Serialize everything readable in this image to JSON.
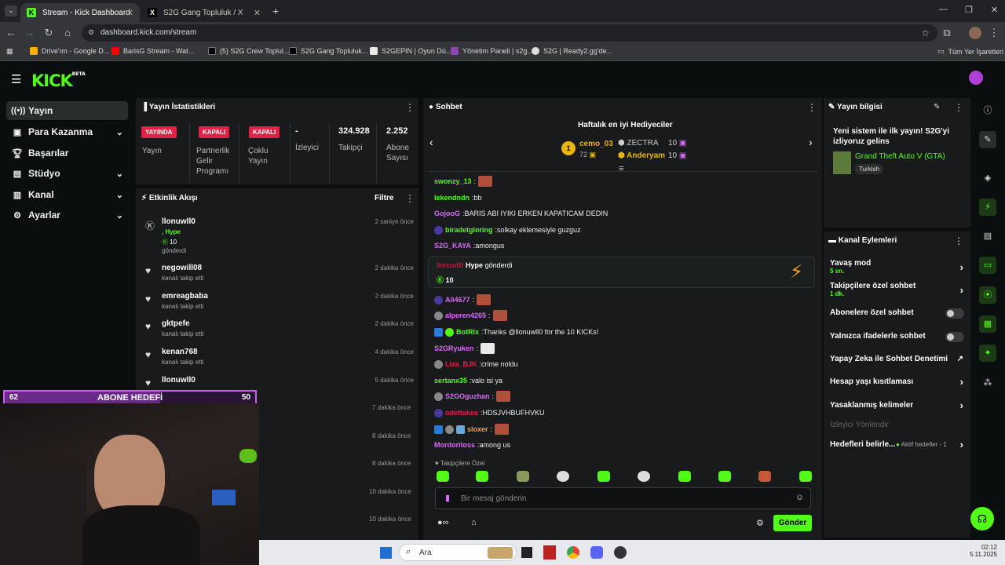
{
  "browser": {
    "tabs": [
      {
        "label": "Stream - Kick Dashboard",
        "active": true
      },
      {
        "label": "S2G Gang Topluluk / X",
        "active": false
      }
    ],
    "url": "dashboard.kick.com/stream",
    "bookmarks": [
      "Drive'ım - Google D...",
      "BarisG Stream - Wat...",
      "(5) S2G Crew Toplul...",
      "S2G Gang Topluluk...",
      "S2GEPIN | Oyun Dü...",
      "Yönetim Paneli | s2g...",
      "S2G | Ready2.gg'de..."
    ],
    "all_bookmarks": "Tüm Yer İşaretleri"
  },
  "header": {
    "logo": "KICK",
    "beta": "BETA"
  },
  "sidebar": {
    "items": [
      {
        "label": "Yayın",
        "active": true
      },
      {
        "label": "Para Kazanma",
        "chevron": true
      },
      {
        "label": "Başarılar"
      },
      {
        "label": "Stüdyo",
        "chevron": true
      },
      {
        "label": "Kanal",
        "chevron": true
      },
      {
        "label": "Ayarlar",
        "chevron": true
      }
    ]
  },
  "stats": {
    "title": "Yayın İstatistikleri",
    "cols": [
      {
        "badge": "YAYINDA",
        "label": "Yayın"
      },
      {
        "badge": "KAPALI",
        "label": "Partnerlik Gelir Programı"
      },
      {
        "badge": "KAPALI",
        "label": "Çoklu Yayın"
      },
      {
        "value": "-",
        "label": "İzleyici"
      },
      {
        "value": "324.928",
        "label": "Takipçi"
      },
      {
        "value": "2.252",
        "label": "Abone Sayısı"
      }
    ]
  },
  "activity": {
    "title": "Etkinlik Akışı",
    "filter": "Filtre",
    "events": [
      {
        "name": "llonuwll0",
        "extra": ", Hype",
        "amount": "10",
        "sub": "gönderdi",
        "time": "2 saniye önce"
      },
      {
        "name": "negowill08",
        "sub": "kanalı takip etti",
        "time": "2 dakika önce"
      },
      {
        "name": "emreagbaba",
        "sub": "kanalı takip etti",
        "time": "2 dakika önce"
      },
      {
        "name": "gktpefe",
        "sub": "kanalı takip etti",
        "time": "2 dakika önce"
      },
      {
        "name": "kenan768",
        "sub": "kanalı takip etti",
        "time": "4 dakika önce"
      },
      {
        "name": "llonuwll0",
        "sub": "kanalı takip etti",
        "time": "5 dakika önce"
      }
    ],
    "more_times": [
      "7 dakika önce",
      "8 dakika önce",
      "8 dakika önce",
      "10 dakika önce",
      "10 dakika önce"
    ]
  },
  "goal": {
    "left": "62",
    "label": "ABONE HEDEFİ",
    "right": "50",
    "progress_fraction": 0.62
  },
  "chat": {
    "title": "Sohbet",
    "gifters_title": "Haftalık en iyi Hediyeciler",
    "gifters": [
      {
        "rank": "1",
        "name": "cemo_03",
        "count": "72"
      },
      {
        "name": "ZECTRA",
        "count": "10"
      },
      {
        "name": "Anderyam",
        "count": "10"
      }
    ],
    "messages": [
      {
        "user": "swonzy_13",
        "text": "",
        "emote": true,
        "color": "#53fc18"
      },
      {
        "user": "lekendndn",
        "text": "bb",
        "color": "#53fc18"
      },
      {
        "user": "GojooG",
        "text": "BARIS ABI IYIKI ERKEN KAPATICAM DEDIN",
        "color": "#d86bf7"
      },
      {
        "user": "biradetgloring",
        "text": "solkay eklemesiyle guzguz",
        "color": "#53fc18"
      },
      {
        "user": "S2G_KAYA",
        "text": "amongus",
        "color": "#d86bf7"
      },
      {
        "user": "Ali4677",
        "text": "",
        "emote": true,
        "color": "#d86bf7"
      },
      {
        "user": "alperen4265",
        "text": "",
        "emote": true,
        "color": "#d86bf7"
      },
      {
        "user": "BotRix",
        "text": "Thanks @llonuwll0 for the 10 KICKs!",
        "color": "#53fc18"
      },
      {
        "user": "S2GRyuken",
        "text": "",
        "emote": true,
        "color": "#d86bf7"
      },
      {
        "user": "Liza_BJK",
        "text": "crime noldu",
        "color": "#e32146"
      },
      {
        "user": "sertanx35",
        "text": "valo isi ya",
        "color": "#53fc18"
      },
      {
        "user": "S2GOguzhan",
        "text": "",
        "emote": true,
        "color": "#d86bf7"
      },
      {
        "user": "odettakes",
        "text": "HDSJVHBUFHVKU",
        "color": "#e32146"
      },
      {
        "user": "sloxer",
        "text": "",
        "emote": true,
        "color": "#ff9b33"
      },
      {
        "user": "Mordoritoss",
        "text": "among us",
        "color": "#d86bf7"
      }
    ],
    "gift": {
      "user": "llonuwll0",
      "kind": "Hype",
      "verb": "gönderdi",
      "amount": "10"
    },
    "followers_only": "Takipçilere Özel",
    "input_placeholder": "Bir mesaj gönderin",
    "send": "Gönder"
  },
  "info": {
    "title": "Yayın bilgisi",
    "stream_title": "Yeni sistem ile ilk yayın! S2G'yi izliyoruz gelins",
    "category": "Grand Theft Auto V (GTA)",
    "tag": "Turkish"
  },
  "actions": {
    "title": "Kanal Eylemleri",
    "items": [
      {
        "label": "Yavaş mod",
        "sub": "5 sn."
      },
      {
        "label": "Takipçilere özel sohbet",
        "sub": "1 dk."
      },
      {
        "label": "Abonelere özel sohbet"
      },
      {
        "label": "Yalnızca ifadelerle sohbet"
      },
      {
        "label": "Yapay Zeka ile Sohbet Denetimi"
      },
      {
        "label": "Hesap yaşı kısıtlaması"
      },
      {
        "label": "Yasaklanmış kelimeler"
      },
      {
        "label": "İzleyici Yönlendir"
      },
      {
        "label": "Hedefleri belirle...",
        "sub": "Aktif hedefler - 1"
      }
    ]
  },
  "taskbar": {
    "search": "Ara",
    "time": "02:12",
    "date": "5.11.2025"
  }
}
